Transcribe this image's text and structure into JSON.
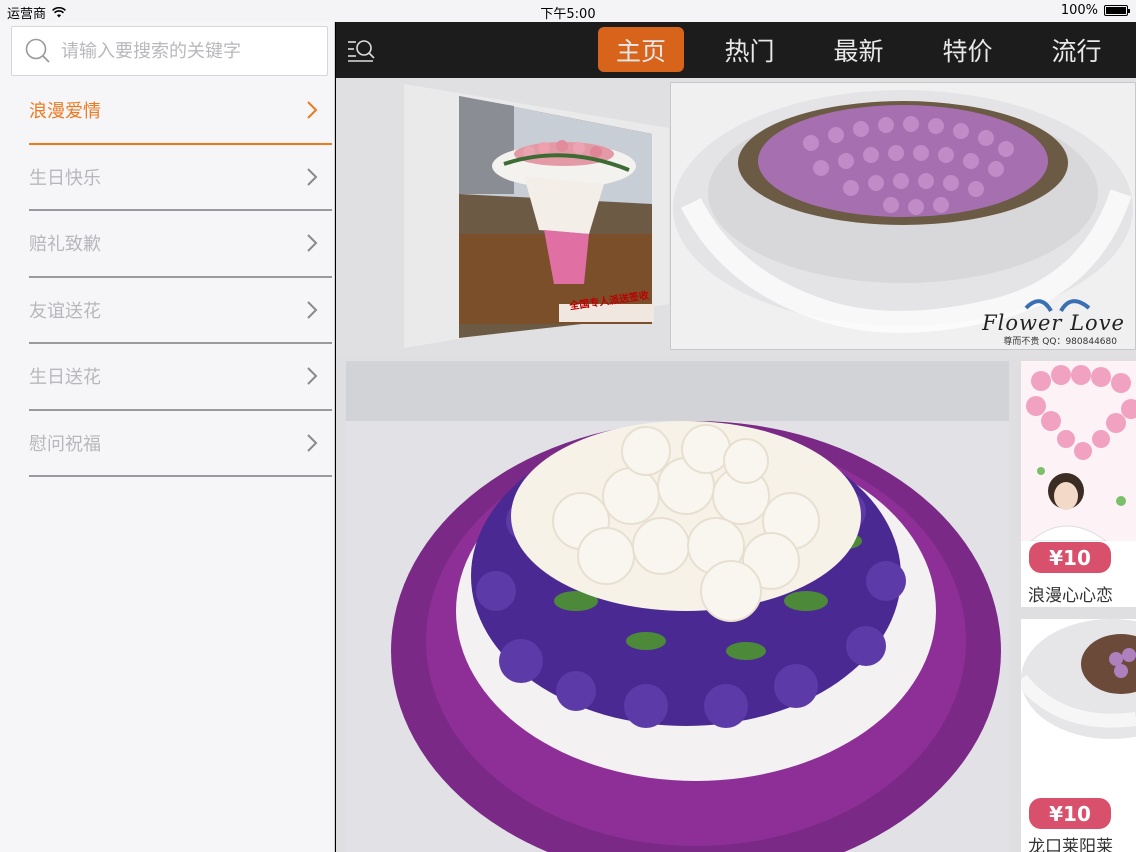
{
  "status_bar": {
    "carrier": "运营商",
    "time": "下午5:00",
    "battery": "100%"
  },
  "sidebar": {
    "search_placeholder": "请输入要搜索的关键字",
    "categories": [
      {
        "label": "浪漫爱情",
        "active": true
      },
      {
        "label": "生日快乐",
        "active": false
      },
      {
        "label": "赔礼致歉",
        "active": false
      },
      {
        "label": "友谊送花",
        "active": false
      },
      {
        "label": "生日送花",
        "active": false
      },
      {
        "label": "慰问祝福",
        "active": false
      }
    ]
  },
  "nav": {
    "tabs": [
      "主页",
      "热门",
      "最新",
      "特价",
      "流行"
    ],
    "active_tab": "主页"
  },
  "carousel": {
    "left_caption": "全国专人派送签收",
    "right_brand": "Flower  Love",
    "right_sub": "尊而不贵 QQ：980844680"
  },
  "thumbnails": [
    {
      "price": "¥10",
      "title": "浪漫心心恋"
    },
    {
      "price": "¥10",
      "title": "龙口莱阳莱"
    }
  ],
  "colors": {
    "accent": "#ee7a1f",
    "nav_bg": "#1c1c1c",
    "price_tag": "#d9506c"
  }
}
